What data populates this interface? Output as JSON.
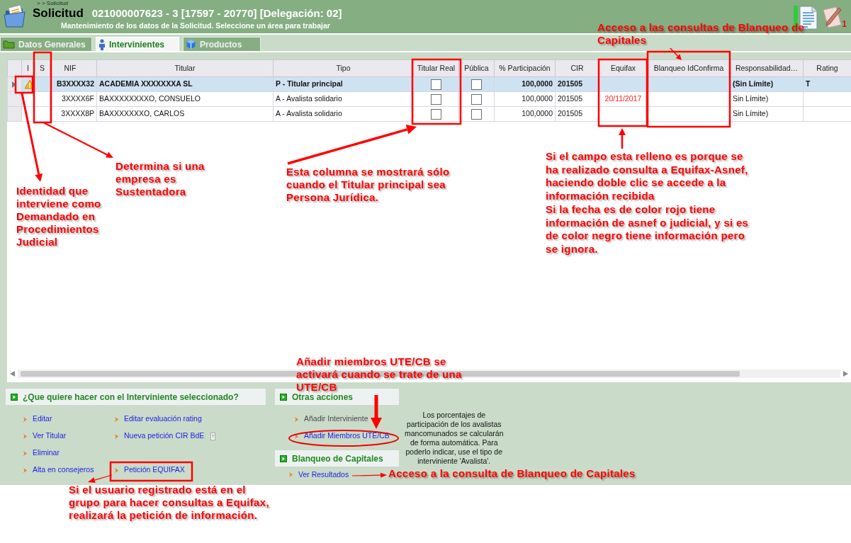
{
  "header": {
    "breadcrumb": "> > Solicitud",
    "title": "Solicitud",
    "record": "021000007623 - 3 [17597 - 20770] [Delegación: 02]",
    "subtitle": "Mantenimiento de los datos de la Solicitud. Seleccione un área para trabajar",
    "badge": "1"
  },
  "tabs": [
    {
      "label": "Datos Generales",
      "selected": false
    },
    {
      "label": "Intervinientes",
      "selected": true
    },
    {
      "label": "Productos",
      "selected": false
    }
  ],
  "grid": {
    "columns": [
      "I",
      "S",
      "NIF",
      "Titular",
      "Tipo",
      "Titular Real",
      "Pública",
      "% Participación",
      "CIR",
      "Equifax",
      "Blanqueo IdConfirma",
      "Responsabilidad…",
      "Rating"
    ],
    "rows": [
      {
        "selected": true,
        "warning": true,
        "nif": "B3XXXX32",
        "titular": "ACADEMIA XXXXXXXA SL",
        "tipo": "P - Titular principal",
        "titular_real_checked": false,
        "publica_checked": false,
        "participacion": "100,0000",
        "cir": "201505",
        "responsabilidad": "(Sin Límite)",
        "rating": "T"
      },
      {
        "selected": false,
        "warning": false,
        "nif": "3XXXX6F",
        "titular": "BAXXXXXXXXO, CONSUELO",
        "tipo": "A - Avalista solidario",
        "titular_real_checked": false,
        "publica_checked": false,
        "participacion": "100,0000",
        "cir": "201505",
        "equifax": "20/11/2017",
        "equifax_alert": true,
        "responsabilidad": "Sin Límite)"
      },
      {
        "selected": false,
        "warning": false,
        "nif": "3XXXX8P",
        "titular": "BAXXXXXXXO, CARLOS",
        "tipo": "A - Avalista solidario",
        "titular_real_checked": false,
        "publica_checked": false,
        "participacion": "100,0000",
        "cir": "201505",
        "responsabilidad": "Sin Límite)"
      }
    ]
  },
  "actions": {
    "title": "¿Que quiere hacer con el Interviniente seleccionado?",
    "rows": [
      [
        {
          "label": "Editar"
        },
        {
          "label": "Editar evaluación rating"
        }
      ],
      [
        {
          "label": "Ver Titular"
        },
        {
          "label": "Nueva petición CIR BdE",
          "badge": "T"
        }
      ],
      [
        {
          "label": "Eliminar"
        }
      ],
      [
        {
          "label": "Alta en consejeros"
        },
        {
          "label": "Petición EQUIFAX"
        }
      ]
    ]
  },
  "other_actions": {
    "title": "Otras acciones",
    "items": [
      {
        "label": "Añadir Interviniente",
        "disabled": true
      },
      {
        "label": "Añadir Miembros UTE/CB",
        "disabled": false
      }
    ]
  },
  "note": "Los porcentajes de\nparticipación de los avalistas\nmancomunados se calcularán\nde forma automática. Para\npoderlo indicar, use el tipo de\ninterviniente 'Avalista'.",
  "capital_laundering": {
    "title": "Blanqueo de Capitales",
    "items": [
      {
        "label": "Ver Resultados"
      }
    ]
  },
  "annotations": [
    {
      "text": "Acceso a las consultas de Blanqueo de\nCapitales"
    },
    {
      "text": "Determina si una\nempresa es\nSustentadora"
    },
    {
      "text": "Identidad que\ninterviene como\nDemandado en\nProcedimientos\nJudicial"
    },
    {
      "text": "Esta columna se mostrará sólo\ncuando el Titular principal sea\nPersona Jurídica."
    },
    {
      "text": "Si el campo esta relleno es porque se\nha realizado consulta a Equifax-Asnef,\nhaciendo doble clic se accede a la\ninformación recibida"
    },
    {
      "text": "Si la fecha es de color rojo tiene\ninformación de asnef o judicial, y si es\nde color negro tiene información pero\nse ignora."
    },
    {
      "text": "Añadir miembros UTE/CB se\nactivará cuando se trate de una\nUTE/CB"
    },
    {
      "text": "Acceso a la consulta de Blanqueo de Capitales"
    },
    {
      "text": "Si el usuario registrado está en el\ngrupo para hacer consultas a Equifax,\nrealizará la petición de información."
    }
  ]
}
